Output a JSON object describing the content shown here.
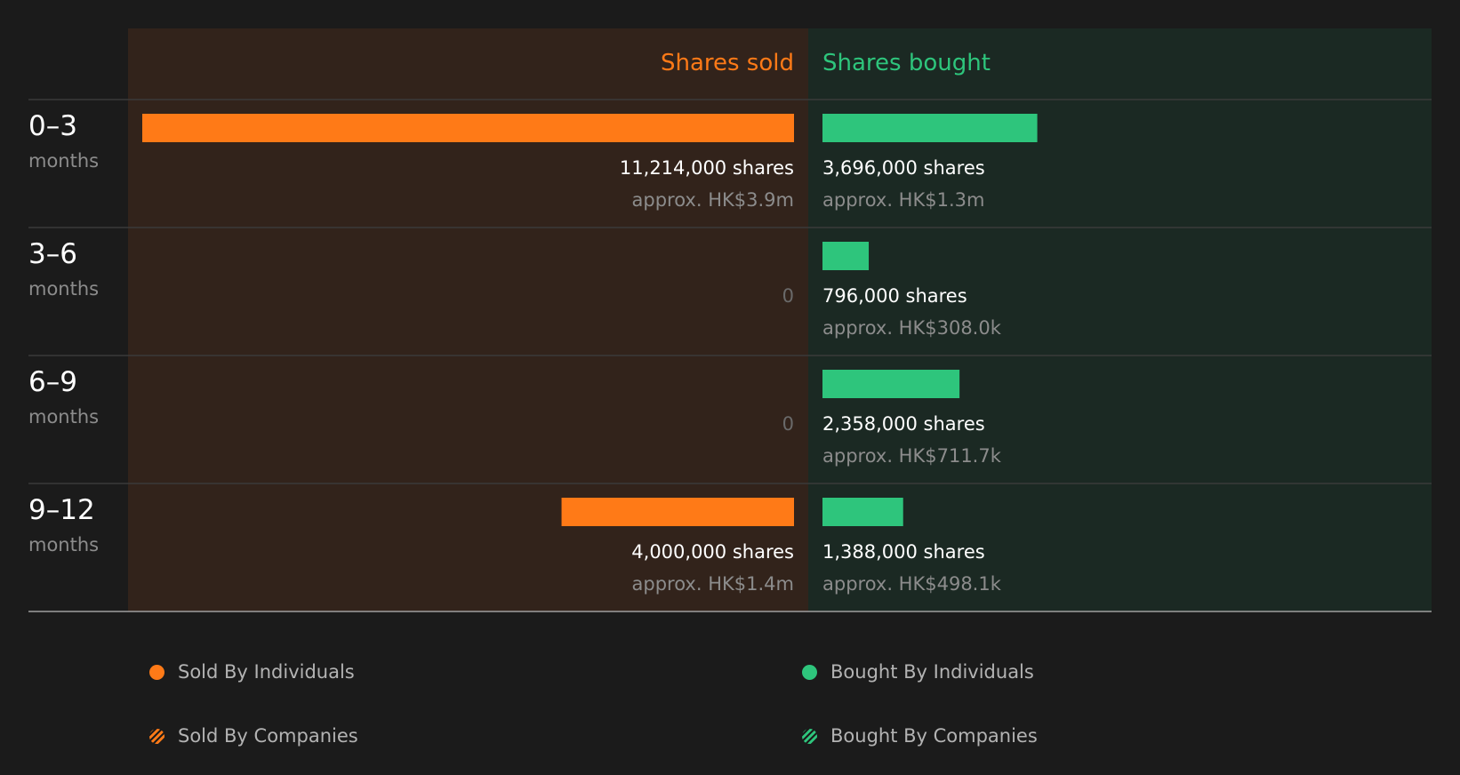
{
  "chart_data": {
    "type": "bar",
    "headers": {
      "sold": "Shares sold",
      "bought": "Shares bought"
    },
    "period_unit": "months",
    "categories": [
      "0–3",
      "3–6",
      "6–9",
      "9–12"
    ],
    "series": [
      {
        "name": "Shares sold",
        "values": [
          11214000,
          0,
          0,
          4000000
        ],
        "labels": [
          "11,214,000 shares",
          "0",
          "0",
          "4,000,000 shares"
        ],
        "values_hkd": [
          "approx. HK$3.9m",
          "",
          "",
          "approx. HK$1.4m"
        ]
      },
      {
        "name": "Shares bought",
        "values": [
          3696000,
          796000,
          2358000,
          1388000
        ],
        "labels": [
          "3,696,000 shares",
          "796,000 shares",
          "2,358,000 shares",
          "1,388,000 shares"
        ],
        "values_hkd": [
          "approx. HK$1.3m",
          "approx. HK$308.0k",
          "approx. HK$711.7k",
          "approx. HK$498.1k"
        ]
      }
    ],
    "xlim": [
      0,
      11214000
    ],
    "legend": [
      {
        "label": "Sold By Individuals",
        "style": "solid",
        "side": "sold"
      },
      {
        "label": "Bought By Individuals",
        "style": "solid",
        "side": "bought"
      },
      {
        "label": "Sold By Companies",
        "style": "hatched",
        "side": "sold"
      },
      {
        "label": "Bought By Companies",
        "style": "hatched",
        "side": "bought"
      }
    ],
    "legend_position": "bottom"
  },
  "colors": {
    "background": "#1b1b1b",
    "sold": "#ff7a17",
    "bought": "#2ec57c",
    "sold_panel": "#32231b",
    "bought_panel": "#1b2923",
    "text": "#ffffff",
    "muted": "#8c8c8c"
  }
}
